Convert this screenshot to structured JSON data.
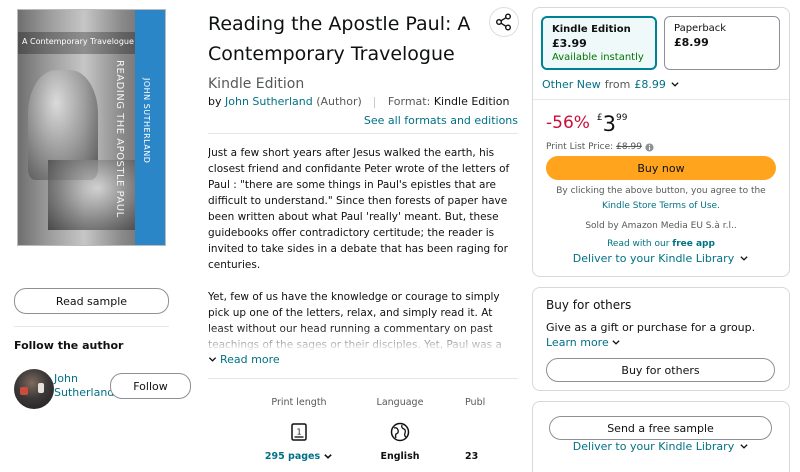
{
  "cover": {
    "subtitle": "A Contemporary Travelogue",
    "title": "READING THE APOSTLE PAUL",
    "author": "JOHN SUTHERLAND"
  },
  "left": {
    "read_sample": "Read sample",
    "follow_heading": "Follow the author",
    "author_name": "John Sutherland",
    "follow_button": "Follow"
  },
  "product": {
    "title": "Reading the Apostle Paul: A Contemporary Travelogue",
    "format_suffix": "Kindle Edition",
    "byline_prefix": "by",
    "author": "John Sutherland",
    "author_role": "(Author)",
    "format_label": "Format:",
    "format_value": "Kindle Edition",
    "see_formats": "See all formats and editions",
    "description": [
      "Just a few short years after Jesus walked the earth, his closest friend and confidante Peter wrote of the letters of Paul : \"there are some things in Paul's epistles that are difficult to understand.\" Since then forests of paper have been written about what Paul 'really' meant. But, these guidebooks offer contradictory certitude; the reader is invited to take sides in a debate that has been raging for centuries.",
      "Yet, few of us have the knowledge or courage to simply pick up one of the letters, relax, and simply read it. At least without our head running a commentary on past teachings of the sages or their disciples. Yet, Paul was a real man,"
    ],
    "read_more": "Read more"
  },
  "details": {
    "print_length": {
      "label": "Print length",
      "value": "295 pages"
    },
    "language": {
      "label": "Language",
      "value": "English"
    },
    "publication": {
      "label": "Publ",
      "value": "23"
    }
  },
  "buybox": {
    "formats": [
      {
        "name": "Kindle Edition",
        "price": "£3.99",
        "availability": "Available instantly"
      },
      {
        "name": "Paperback",
        "price": "£8.99"
      }
    ],
    "other_new_link": "Other New",
    "other_new_from": "from",
    "other_new_price": "£8.99",
    "discount": "-56%",
    "price_currency": "£",
    "price_whole": "3",
    "price_fraction": "99",
    "list_price_label": "Print List Price:",
    "list_price": "£8.99",
    "buy_now": "Buy now",
    "agree_text": "By clicking the above button, you agree to the",
    "terms_link": "Kindle Store Terms of Use.",
    "sold_by": "Sold by Amazon Media EU S.à r.l..",
    "read_with": "Read with our",
    "free_app": "free app",
    "deliver": "Deliver to your Kindle Library"
  },
  "gift": {
    "title": "Buy for others",
    "description": "Give as a gift or purchase for a group.",
    "learn_more": "Learn more",
    "button": "Buy for others"
  },
  "sample": {
    "button": "Send a free sample",
    "deliver": "Deliver to your Kindle Library"
  },
  "colors": {
    "link": "#007185",
    "buy_now": "#ffa41c",
    "discount": "#cc0c39",
    "available": "#007600",
    "selected_border": "#008296"
  }
}
